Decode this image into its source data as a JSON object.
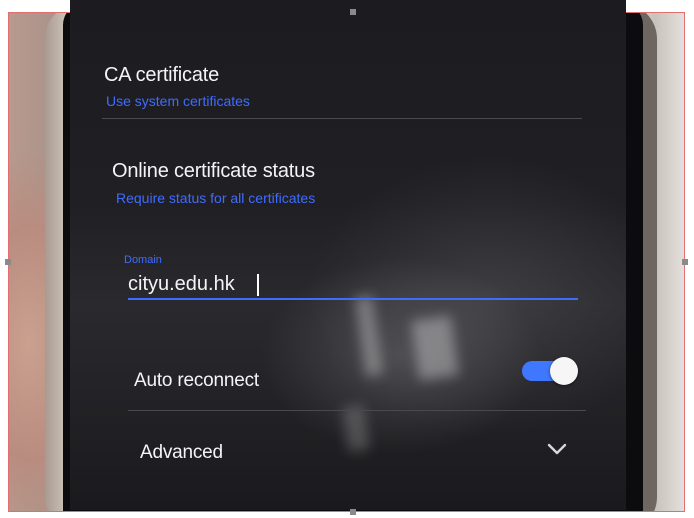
{
  "ca_certificate": {
    "title": "CA certificate",
    "value": "Use system certificates"
  },
  "online_certificate_status": {
    "title": "Online certificate status",
    "value": "Require status for all certificates"
  },
  "domain": {
    "label": "Domain",
    "value": "cityu.edu.hk"
  },
  "auto_reconnect": {
    "label": "Auto reconnect",
    "enabled": true
  },
  "advanced": {
    "label": "Advanced",
    "icon": "chevron-down-icon"
  },
  "colors": {
    "accent": "#3f6bff",
    "background": "#1e1e22",
    "text": "#f4f4f6"
  }
}
